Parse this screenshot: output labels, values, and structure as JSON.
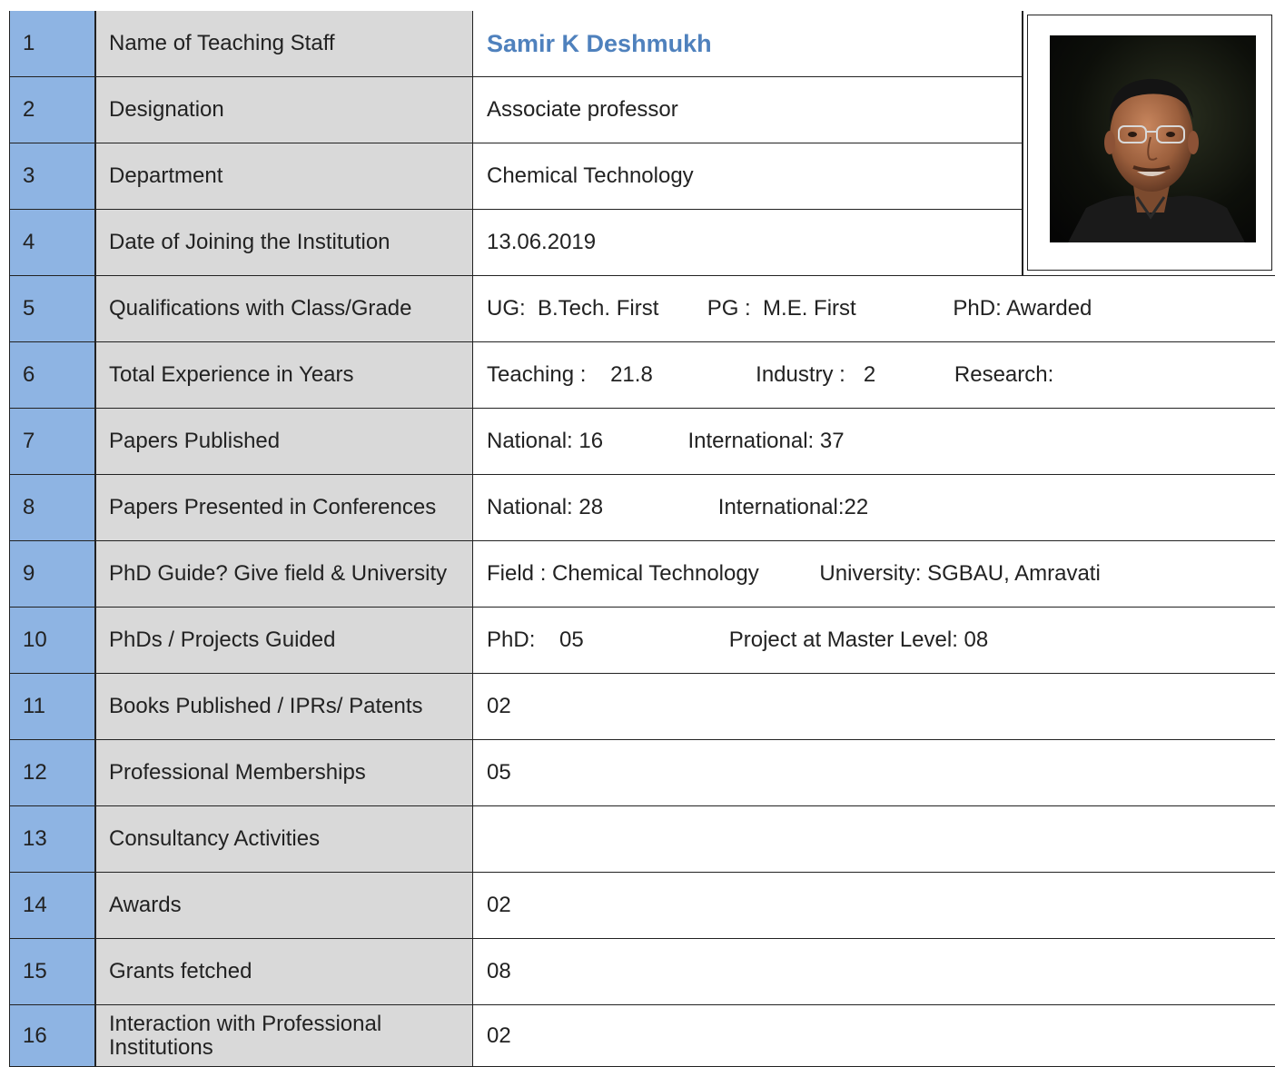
{
  "rows": [
    {
      "num": "1",
      "label": "Name of Teaching Staff",
      "value": "Samir K Deshmukh"
    },
    {
      "num": "2",
      "label": "Designation",
      "value": "Associate professor"
    },
    {
      "num": "3",
      "label": "Department",
      "value": "Chemical Technology"
    },
    {
      "num": "4",
      "label": "Date of Joining the Institution",
      "value": "13.06.2019"
    },
    {
      "num": "5",
      "label": "Qualifications with Class/Grade",
      "value": "UG:  B.Tech. First        PG :  M.E. First                PhD: Awarded"
    },
    {
      "num": "6",
      "label": "Total Experience in Years",
      "value": "Teaching :    21.8                 Industry :   2             Research:"
    },
    {
      "num": "7",
      "label": "Papers Published",
      "value": "National: 16              International: 37"
    },
    {
      "num": "8",
      "label": "Papers Presented in Conferences",
      "value": "National: 28                   International:22"
    },
    {
      "num": "9",
      "label": "PhD Guide? Give field & University",
      "value": "Field : Chemical Technology          University: SGBAU, Amravati"
    },
    {
      "num": "10",
      "label": "PhDs / Projects Guided",
      "value": "PhD:    05                        Project at Master Level: 08"
    },
    {
      "num": "11",
      "label": "Books Published / IPRs/ Patents",
      "value": "02"
    },
    {
      "num": "12",
      "label": "Professional Memberships",
      "value": "05"
    },
    {
      "num": "13",
      "label": "Consultancy Activities",
      "value": ""
    },
    {
      "num": "14",
      "label": "Awards",
      "value": "02"
    },
    {
      "num": "15",
      "label": "Grants fetched",
      "value": "08"
    },
    {
      "num": "16",
      "label": "Interaction with Professional Institutions",
      "value": "02"
    }
  ],
  "colors": {
    "number_column": "#8eb4e3",
    "label_column": "#d9d9d9",
    "name_text": "#4f81bd"
  }
}
